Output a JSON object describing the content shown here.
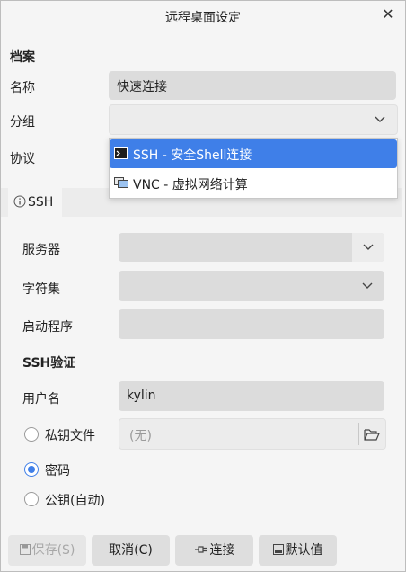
{
  "window": {
    "title": "远程桌面设定",
    "close_glyph": "✕"
  },
  "profile": {
    "section_label": "档案",
    "name_label": "名称",
    "name_value": "快速连接",
    "group_label": "分组",
    "group_value": "",
    "protocol_label": "协议"
  },
  "protocol_dropdown": {
    "options": [
      {
        "label": "SSH - 安全Shell连接",
        "icon": "terminal-icon",
        "selected": true
      },
      {
        "label": "VNC - 虚拟网络计算",
        "icon": "screens-icon",
        "selected": false
      }
    ]
  },
  "tabs": [
    {
      "label": "SSH",
      "icon": "info-icon"
    }
  ],
  "ssh": {
    "server_label": "服务器",
    "server_value": "",
    "charset_label": "字符集",
    "charset_value": "",
    "startup_label": "启动程序",
    "startup_value": "",
    "auth_section_label": "SSH验证",
    "username_label": "用户名",
    "username_value": "kylin",
    "auth_options": [
      {
        "label": "私钥文件",
        "selected": false
      },
      {
        "label": "密码",
        "selected": true
      },
      {
        "label": "公钥(自动)",
        "selected": false
      }
    ],
    "keyfile_value": "(无)"
  },
  "buttons": {
    "save": "保存(S)",
    "cancel": "取消(C)",
    "connect": "连接",
    "default": "默认值"
  },
  "colors": {
    "accent": "#3f7fe8"
  }
}
